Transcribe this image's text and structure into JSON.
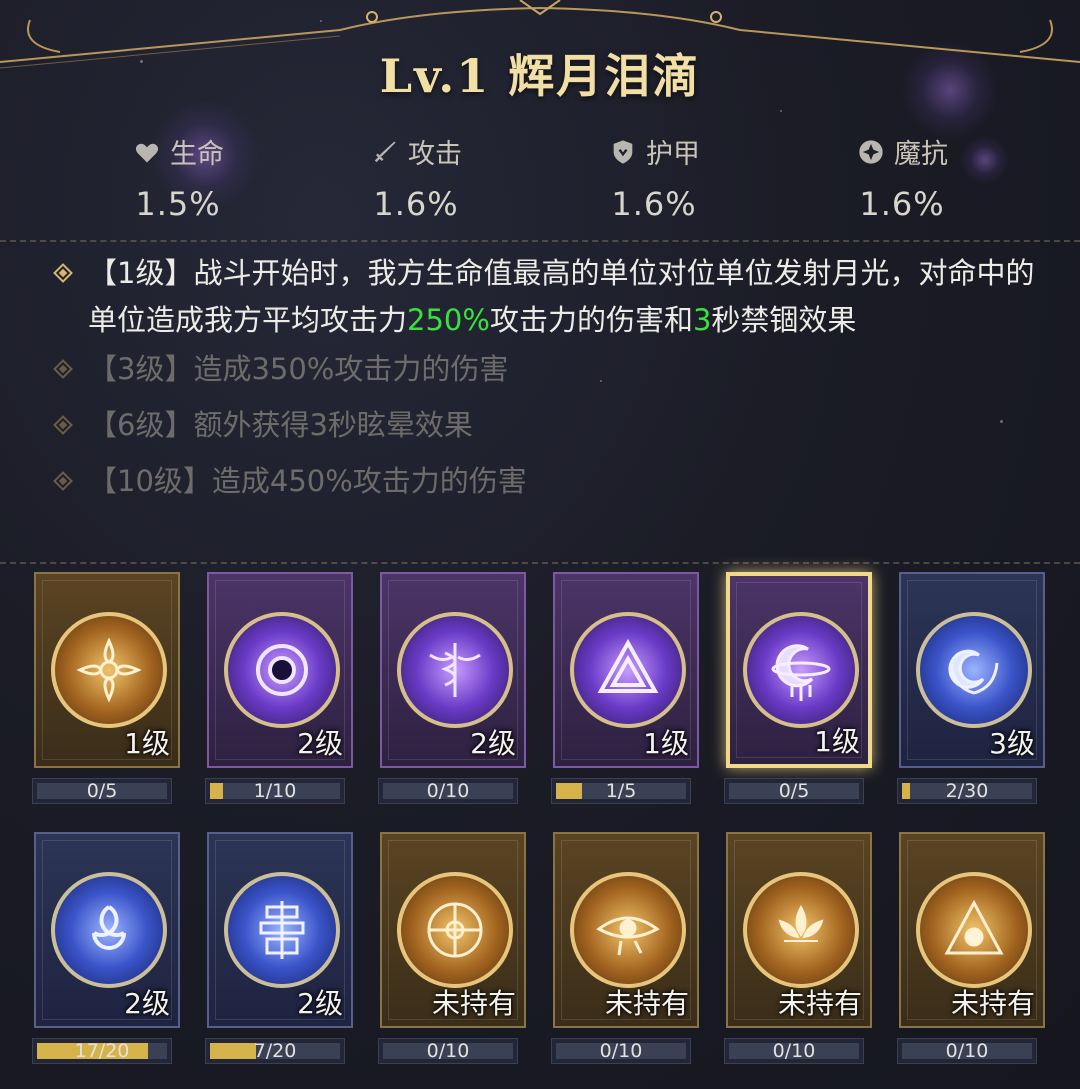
{
  "artifact": {
    "title": "Lv.1 辉月泪滴"
  },
  "stats": [
    {
      "icon": "heart-icon",
      "label": "生命",
      "value": "1.5%"
    },
    {
      "icon": "sword-icon",
      "label": "攻击",
      "value": "1.6%"
    },
    {
      "icon": "shield-icon",
      "label": "护甲",
      "value": "1.6%"
    },
    {
      "icon": "magic-resist-icon",
      "label": "魔抗",
      "value": "1.6%"
    }
  ],
  "effects": {
    "lv1": {
      "prefix": "【1级】战斗开始时，我方生命值最高的单位对位单位发射月光，对命中的单位造成我方平均攻击力",
      "pct": "250%",
      "mid": "攻击力的伤害和",
      "sec": "3",
      "suffix": "秒禁锢效果"
    },
    "lv3": "【3级】造成350%攻击力的伤害",
    "lv6": "【6级】额外获得3秒眩晕效果",
    "lv10": "【10级】造成450%攻击力的伤害"
  },
  "colors": {
    "highlight": "#38e23e",
    "gold": "#f1dfa6",
    "selected_border": "#f2d98a"
  },
  "cards": [
    {
      "name": "flower-emblem",
      "tier": "gold",
      "level": "1级",
      "progress": "0/5",
      "fill": 0,
      "selected": false
    },
    {
      "name": "vortex-emblem",
      "tier": "purple",
      "level": "2级",
      "progress": "1/10",
      "fill": 0.1,
      "selected": false
    },
    {
      "name": "caduceus-emblem",
      "tier": "purple",
      "level": "2级",
      "progress": "0/10",
      "fill": 0,
      "selected": false
    },
    {
      "name": "valknut-emblem",
      "tier": "purple",
      "level": "1级",
      "progress": "1/5",
      "fill": 0.2,
      "selected": false
    },
    {
      "name": "moon-tear-emblem",
      "tier": "purple",
      "level": "1级",
      "progress": "0/5",
      "fill": 0,
      "selected": true
    },
    {
      "name": "crescent-laurel-emblem",
      "tier": "blue",
      "level": "3级",
      "progress": "2/30",
      "fill": 0.067,
      "selected": false
    },
    {
      "name": "triple-horn-emblem",
      "tier": "blue",
      "level": "2级",
      "progress": "17/20",
      "fill": 0.85,
      "selected": false
    },
    {
      "name": "seal-emblem",
      "tier": "blue",
      "level": "2级",
      "progress": "7/20",
      "fill": 0.35,
      "selected": false
    },
    {
      "name": "wheel-emblem",
      "tier": "gold",
      "level": "未持有",
      "progress": "0/10",
      "fill": 0,
      "selected": false
    },
    {
      "name": "eye-emblem",
      "tier": "gold",
      "level": "未持有",
      "progress": "0/10",
      "fill": 0,
      "selected": false
    },
    {
      "name": "lotus-emblem",
      "tier": "gold",
      "level": "未持有",
      "progress": "0/10",
      "fill": 0,
      "selected": false
    },
    {
      "name": "pyramid-emblem",
      "tier": "gold",
      "level": "未持有",
      "progress": "0/10",
      "fill": 0,
      "selected": false
    }
  ]
}
